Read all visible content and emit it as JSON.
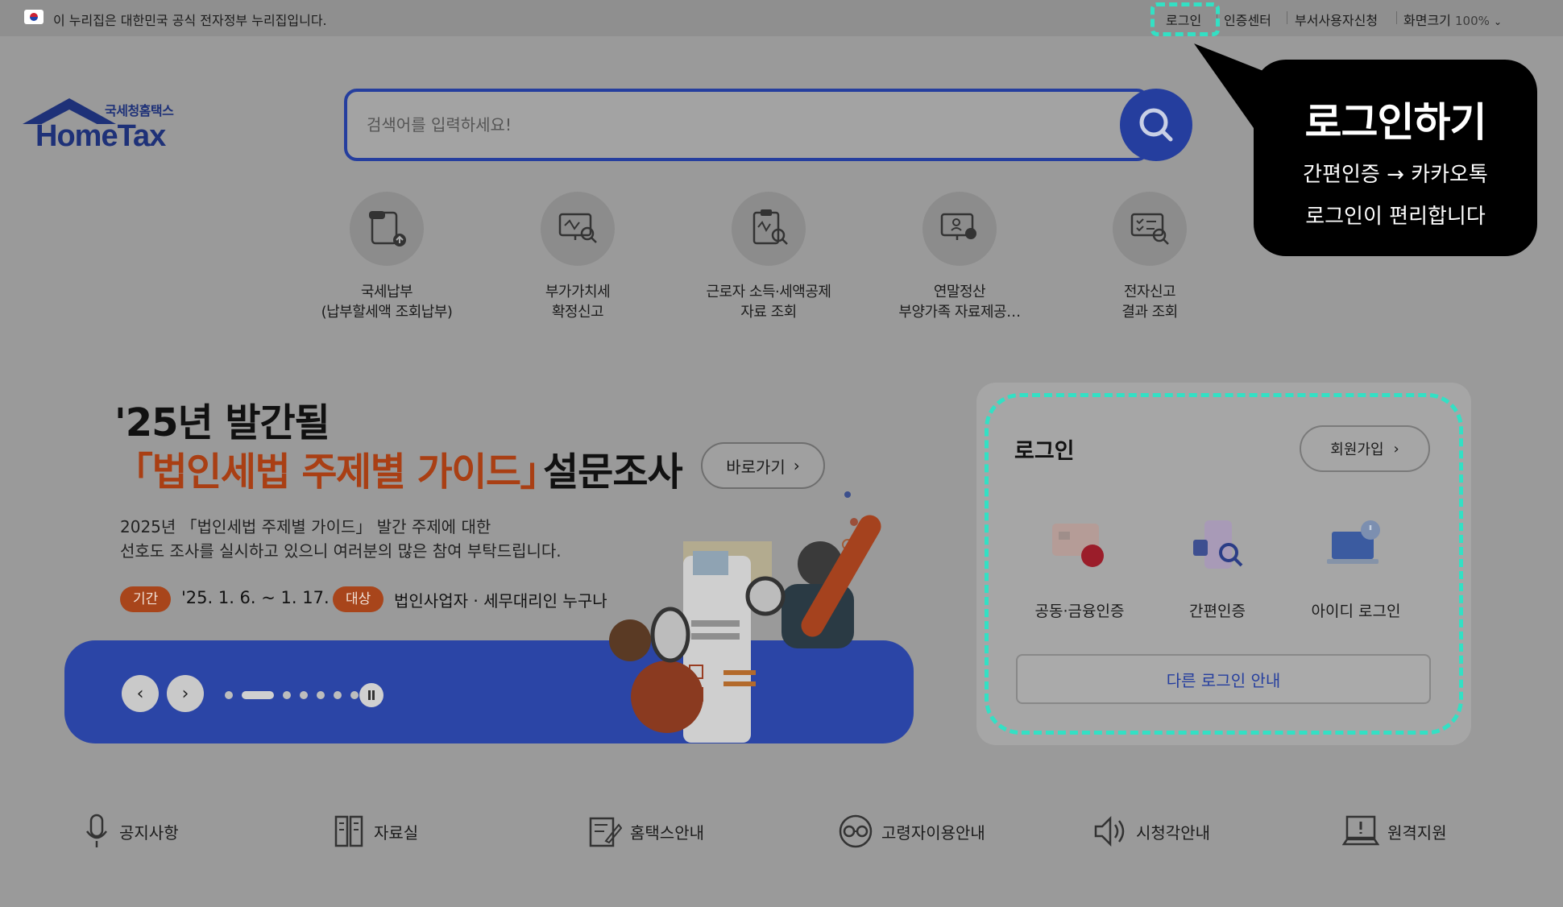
{
  "gov_bar": {
    "notice": "이 누리집은 대한민국 공식 전자정부 누리집입니다.",
    "links": [
      "로그인",
      "인증센터",
      "부서사용자신청"
    ],
    "zoom_label": "화면크기",
    "zoom_value": "100%"
  },
  "logo": {
    "sub": "국세청홈택스",
    "main": "HomeTax"
  },
  "search": {
    "placeholder": "검색어를 입력하세요!"
  },
  "quick_menu": [
    {
      "label": "국세납부\n(납부할세액 조회납부)",
      "icon": "tax-payment-icon"
    },
    {
      "label": "부가가치세\n확정신고",
      "icon": "vat-report-icon"
    },
    {
      "label": "근로자 소득·세액공제\n자료 조회",
      "icon": "worker-deduction-icon"
    },
    {
      "label": "연말정산\n부양가족 자료제공…",
      "icon": "year-end-settlement-icon"
    },
    {
      "label": "전자신고\n결과 조회",
      "icon": "e-filing-result-icon"
    }
  ],
  "banner": {
    "title_line1": "'25년 발간될",
    "title_highlight": "「법인세법 주제별 가이드」",
    "title_rest": "설문조사",
    "go_label": "바로가기",
    "desc_line1": "2025년 「법인세법 주제별 가이드」 발간 주제에 대한",
    "desc_line2": "선호도 조사를 실시하고 있으니 여러분의 많은 참여 부탁드립니다.",
    "period_tag": "기간",
    "period_value": "'25. 1. 6. ~ 1. 17.",
    "target_tag": "대상",
    "target_value": "법인사업자 · 세무대리인 누구나",
    "slide_count": 8,
    "active_slide": 2
  },
  "login": {
    "title": "로그인",
    "join_label": "회원가입",
    "options": [
      {
        "label": "공동·금융인증",
        "icon": "certificate-card-icon"
      },
      {
        "label": "간편인증",
        "icon": "simple-auth-icon"
      },
      {
        "label": "아이디 로그인",
        "icon": "id-login-laptop-icon"
      }
    ],
    "other_label": "다른 로그인 안내"
  },
  "tooltip": {
    "title": "로그인하기",
    "line1": "간편인증 → 카카오톡",
    "line2": "로그인이 편리합니다"
  },
  "bottom_links": [
    {
      "label": "공지사항",
      "icon": "microphone-icon"
    },
    {
      "label": "자료실",
      "icon": "archive-icon"
    },
    {
      "label": "홈택스안내",
      "icon": "guide-edit-icon"
    },
    {
      "label": "고령자이용안내",
      "icon": "elderly-glasses-icon"
    },
    {
      "label": "시청각안내",
      "icon": "speaker-icon"
    },
    {
      "label": "원격지원",
      "icon": "remote-support-icon"
    }
  ],
  "colors": {
    "brand_navy": "#253e9e",
    "banner_accent": "#a93f14",
    "highlight": "#33e0c4",
    "overlay_bg": "#9a9a9a"
  }
}
